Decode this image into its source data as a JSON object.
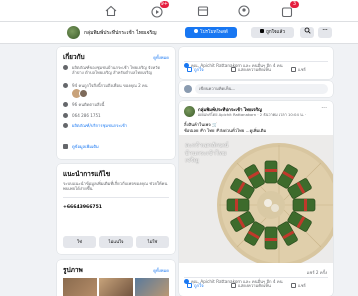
{
  "topnav": {
    "icons": [
      "home-icon",
      "watch-icon",
      "marketplace-icon",
      "groups-icon",
      "gaming-icon"
    ],
    "badges": {
      "watch": "9+",
      "gaming": "3"
    }
  },
  "page_header": {
    "name": "กลุ่มพิมพ์ประทีปกระเช้า ไทยเจริญ",
    "promote_label": "โปรโมทโพสต์",
    "like_label": "ถูกใจแล้ว",
    "search_icon": "search-icon",
    "more_icon": "more-icon"
  },
  "about": {
    "title": "เกี่ยวกับ",
    "see_all": "ดูทั้งหมด",
    "description": "ผลิตภัณฑ์ของชุมชนบ้านกระเช้า ไทยเจริญ จังหวัดลำปาง ตำบลไทยเจริญ สำหรับตำบลไทยเจริญ",
    "likes_text": "94 คนถูกใจสิ่งนี้รวมถึงเพื่อน ของคุณ 2 คน",
    "follows_text": "96 คนติดตามสิ่งนี้",
    "phone": "064 286 1751",
    "category": "ผลิตภัณฑ์/บริการชุมชนกระเช้า",
    "edit_link": "ดูข้อมูลเพิ่มเติม"
  },
  "recommend": {
    "title": "แนะนำการแก้ไข",
    "body": "ระบบแนะนำข้อมูลเพิ่มเติมที่เกี่ยวกับเพจของคุณ ช่วยให้คนพบเพจได้ง่ายขึ้น",
    "phone": "+66643966751",
    "yes": "ใช่",
    "not_sure": "ไม่แน่ใจ",
    "no": "ไม่ใช่"
  },
  "photos": {
    "title": "รูปภาพ",
    "see_all": "ดูทั้งหมด"
  },
  "top_post": {
    "reactions_text": "คุณ, Apichit Rattanakorn และ คนอื่นๆ อีก 4 คน",
    "like": "ถูกใจ",
    "comment": "แสดงความคิดเห็น",
    "share": "แชร์"
  },
  "comment_box": {
    "placeholder": "เขียนความคิดเห็น..."
  },
  "post": {
    "author": "กลุ่มพิมพ์ประทีปกระเช้า ไทยเจริญ",
    "meta": "เผยแพร่โดย Apichit Rattanakorn · 2 ธันวาคม เวลา 10:04 น. ·",
    "text_line1": "ลิ้งสินค้าในเพจ 🛒",
    "text_line2": "ช้อปเลย #ก ไทย #ส่งด่วนทั่วไทย ...ดูเพิ่มเติม",
    "image_caption": "ตะกร้าเอกลักษณ์บ้านกระเช้าไทยเจริญ",
    "reactions_text": "คุณ, Apichit Rattanakorn และ คนอื่นๆ อีก 4 คน",
    "shares_text": "แชร์ 2 ครั้ง",
    "like": "ถูกใจ",
    "comment": "แสดงความคิดเห็น",
    "share": "แชร์"
  },
  "colors": {
    "accent": "#1877f2",
    "badge": "#e41e3f",
    "bg": "#f0f2f5"
  }
}
